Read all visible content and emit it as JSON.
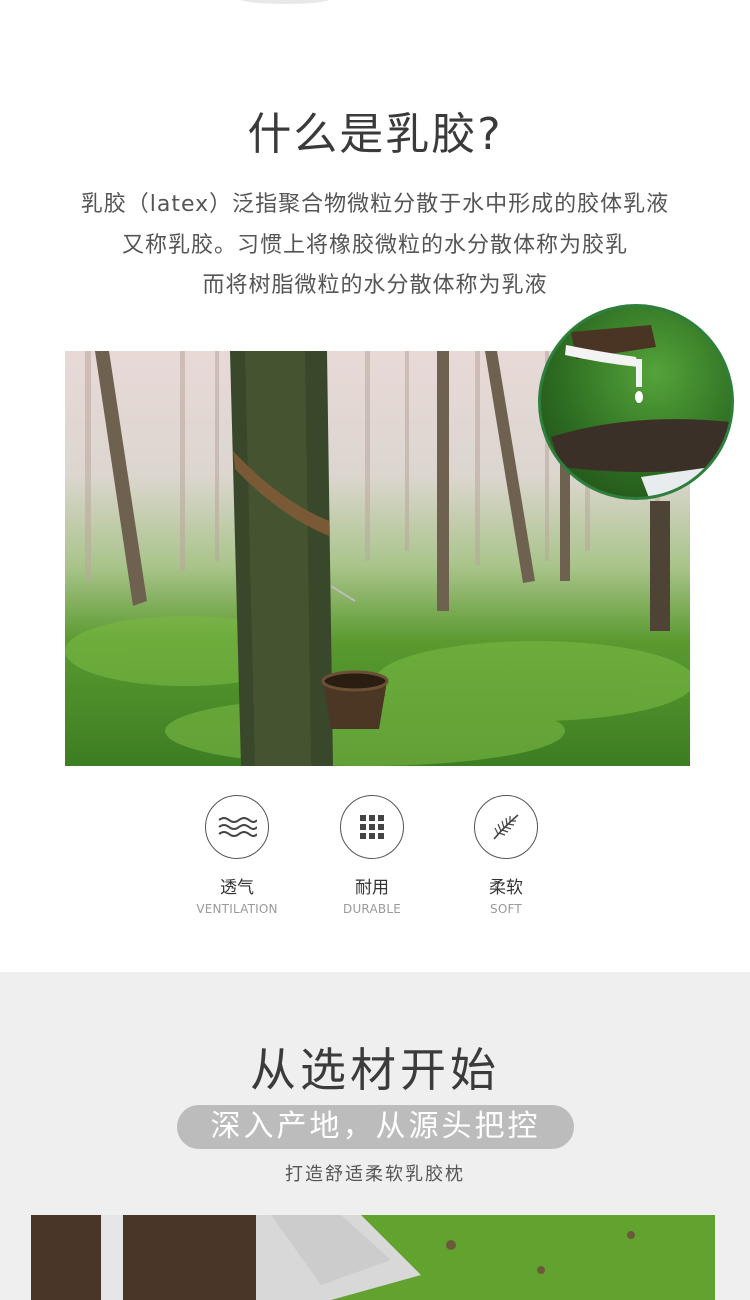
{
  "intro": {
    "title": "什么是乳胶?",
    "description": [
      "乳胶（latex）泛指聚合物微粒分散于水中形成的胶体乳液",
      "又称乳胶。习惯上将橡胶微粒的水分散体称为胶乳",
      "而将树脂微粒的水分散体称为乳液"
    ]
  },
  "features": [
    {
      "icon": "wave-icon",
      "cn": "透气",
      "en": "VENTILATION"
    },
    {
      "icon": "dot-grid-icon",
      "cn": "耐用",
      "en": "DURABLE"
    },
    {
      "icon": "feather-icon",
      "cn": "柔软",
      "en": "SOFT"
    }
  ],
  "sourcing": {
    "title": "从选材开始",
    "pill": "深入产地，从源头把控",
    "subtitle": "打造舒适柔软乳胶枕"
  },
  "colors": {
    "pill_bg": "#bcbcbc",
    "section_bg": "#efefef",
    "inset_border": "#2f7f3c"
  }
}
